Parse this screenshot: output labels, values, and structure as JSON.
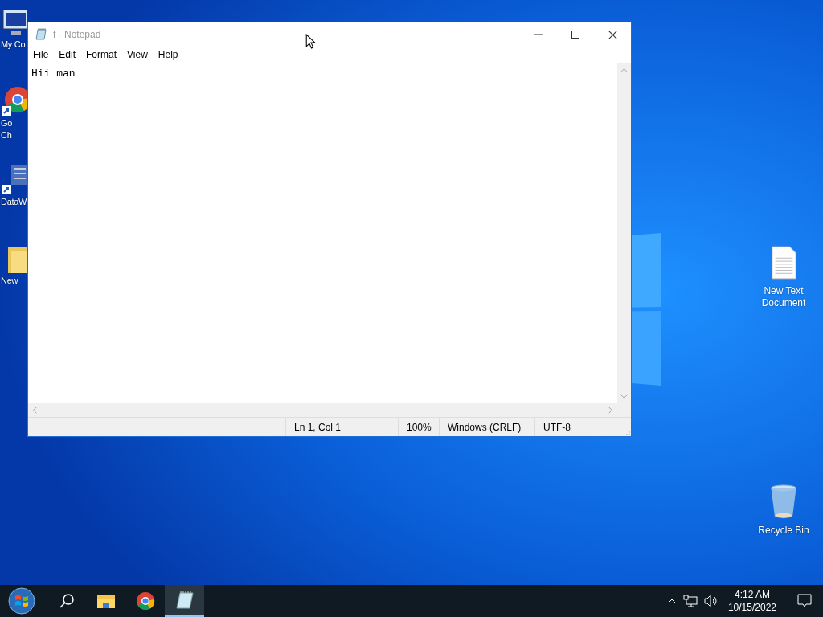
{
  "desktop_icons_left": [
    {
      "kind": "computer",
      "lines": [
        "My Co"
      ]
    },
    {
      "kind": "chrome",
      "lines": [
        "Go",
        "Ch"
      ]
    },
    {
      "kind": "app",
      "lines": [
        "DataW"
      ]
    },
    {
      "kind": "folder",
      "lines": [
        "New"
      ]
    }
  ],
  "desktop_icons_right": [
    {
      "kind": "textfile",
      "lines": [
        "New Text",
        "Document"
      ]
    },
    {
      "kind": "recycle",
      "lines": [
        "Recycle Bin"
      ]
    }
  ],
  "window": {
    "title": "f - Notepad",
    "menu": [
      "File",
      "Edit",
      "Format",
      "View",
      "Help"
    ],
    "content": "Hii man",
    "status_bar": [
      "Ln 1, Col 1",
      "100%",
      "Windows (CRLF)",
      "UTF-8"
    ]
  },
  "taskbar": {
    "apps": [
      {
        "kind": "search",
        "active": false
      },
      {
        "kind": "explorer",
        "active": false
      },
      {
        "kind": "chrome",
        "active": false
      },
      {
        "kind": "notepad",
        "active": true
      }
    ],
    "time": "4:12 AM",
    "date": "10/15/2022"
  }
}
